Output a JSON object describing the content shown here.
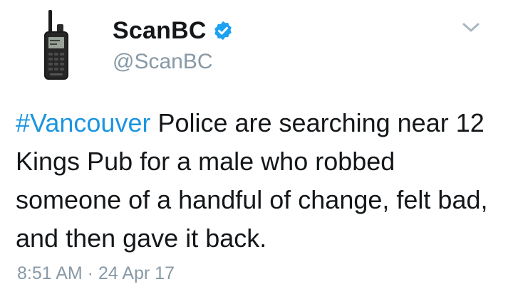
{
  "tweet": {
    "avatar_icon": "radio-scanner-icon",
    "display_name": "ScanBC",
    "verified_icon": "verified-badge-icon",
    "handle": "@ScanBC",
    "menu_icon": "chevron-down-icon",
    "hashtag": "#Vancouver",
    "body": " Police are searching near 12 Kings Pub for a male who robbed someone of a handful of change, felt bad, and then gave it back.",
    "timestamp": "8:51 AM · 24 Apr 17"
  },
  "colors": {
    "link": "#1b95e0",
    "text": "#14171a",
    "secondary": "#8899a6",
    "verified": "#1da1f2"
  }
}
